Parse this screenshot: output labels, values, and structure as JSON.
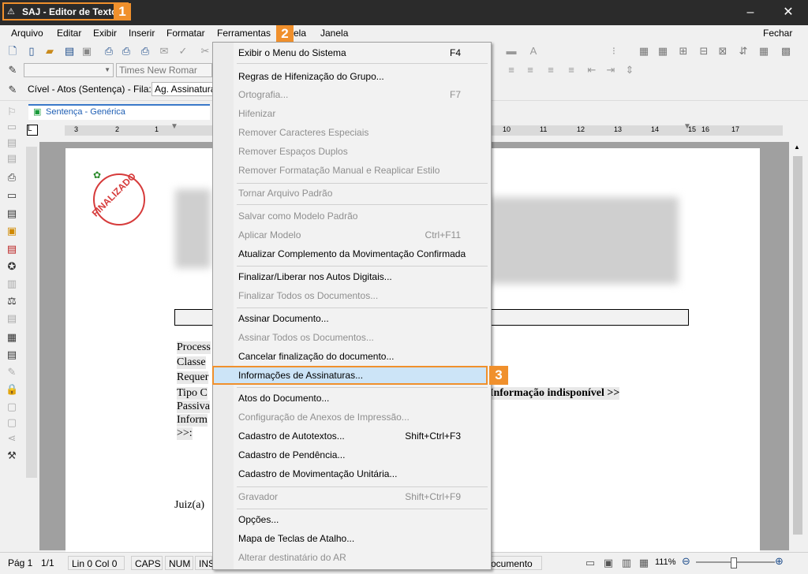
{
  "window": {
    "title": "SAJ - Editor de Textos",
    "badge1": "1",
    "minimize": "–",
    "close": "✕"
  },
  "menubar": {
    "items": [
      "Arquivo",
      "Editar",
      "Exibir",
      "Inserir",
      "Formatar",
      "Ferramentas",
      "ela",
      "Janela"
    ],
    "badge2": "2",
    "close_label": "Fechar"
  },
  "toolbar2": {
    "font_name": "Times New Romar"
  },
  "toolbar3": {
    "info": "Cível - Atos (Sentença) - Fila:",
    "queue": "Ag. Assinatura"
  },
  "doc_tab": {
    "label": "Sentença - Genérica"
  },
  "ruler": {
    "left_nums": [
      "3",
      "2",
      "1"
    ],
    "right_nums": [
      "10",
      "11",
      "12",
      "13",
      "14",
      "15",
      "16",
      "17"
    ]
  },
  "document": {
    "stamp": "FINALIZADO",
    "lines": [
      "Process",
      "Classe",
      "Requer",
      "Tipo C",
      "Passiva",
      "Inform",
      ">>:",
      "Juiz(a)"
    ],
    "info_unavailable": "Informação indisponível >>"
  },
  "menu": {
    "items": [
      {
        "label": "Exibir o Menu do Sistema",
        "shortcut": "F4",
        "disabled": false
      },
      {
        "label": "Regras de Hifenização do Grupo...",
        "shortcut": "",
        "disabled": false
      },
      {
        "label": "Ortografia...",
        "shortcut": "F7",
        "disabled": true
      },
      {
        "label": "Hifenizar",
        "shortcut": "",
        "disabled": true
      },
      {
        "label": "Remover Caracteres Especiais",
        "shortcut": "",
        "disabled": true
      },
      {
        "label": "Remover Espaços Duplos",
        "shortcut": "",
        "disabled": true
      },
      {
        "label": "Remover Formatação Manual e Reaplicar Estilo",
        "shortcut": "",
        "disabled": true
      },
      {
        "label": "Tornar Arquivo Padrão",
        "shortcut": "",
        "disabled": true
      },
      {
        "label": "Salvar como Modelo Padrão",
        "shortcut": "",
        "disabled": true
      },
      {
        "label": "Aplicar Modelo",
        "shortcut": "Ctrl+F11",
        "disabled": true
      },
      {
        "label": "Atualizar Complemento da Movimentação Confirmada",
        "shortcut": "",
        "disabled": false
      },
      {
        "label": "Finalizar/Liberar nos Autos Digitais...",
        "shortcut": "",
        "disabled": false
      },
      {
        "label": "Finalizar Todos os Documentos...",
        "shortcut": "",
        "disabled": true
      },
      {
        "label": "Assinar Documento...",
        "shortcut": "",
        "disabled": false
      },
      {
        "label": "Assinar Todos os Documentos...",
        "shortcut": "",
        "disabled": true
      },
      {
        "label": "Cancelar finalização do documento...",
        "shortcut": "",
        "disabled": false
      },
      {
        "label": "Informações de Assinaturas...",
        "shortcut": "",
        "disabled": false
      },
      {
        "label": "Atos do Documento...",
        "shortcut": "",
        "disabled": false
      },
      {
        "label": "Configuração de Anexos de Impressão...",
        "shortcut": "",
        "disabled": true
      },
      {
        "label": "Cadastro de Autotextos...",
        "shortcut": "Shift+Ctrl+F3",
        "disabled": false
      },
      {
        "label": "Cadastro de Pendência...",
        "shortcut": "",
        "disabled": false
      },
      {
        "label": "Cadastro de Movimentação Unitária...",
        "shortcut": "",
        "disabled": false
      },
      {
        "label": "Gravador",
        "shortcut": "Shift+Ctrl+F9",
        "disabled": true
      },
      {
        "label": "Opções...",
        "shortcut": "",
        "disabled": false
      },
      {
        "label": "Mapa de Teclas de Atalho...",
        "shortcut": "",
        "disabled": false
      },
      {
        "label": "Alterar destinatário do AR",
        "shortcut": "",
        "disabled": true
      }
    ],
    "badge3": "3"
  },
  "statusbar": {
    "page": "Pág 1",
    "pages": "1/1",
    "position": "Lin 0  Col 0",
    "caps": "CAPS",
    "num": "NUM",
    "ins": "INS",
    "doc": "ocumento",
    "zoom": "111%"
  }
}
